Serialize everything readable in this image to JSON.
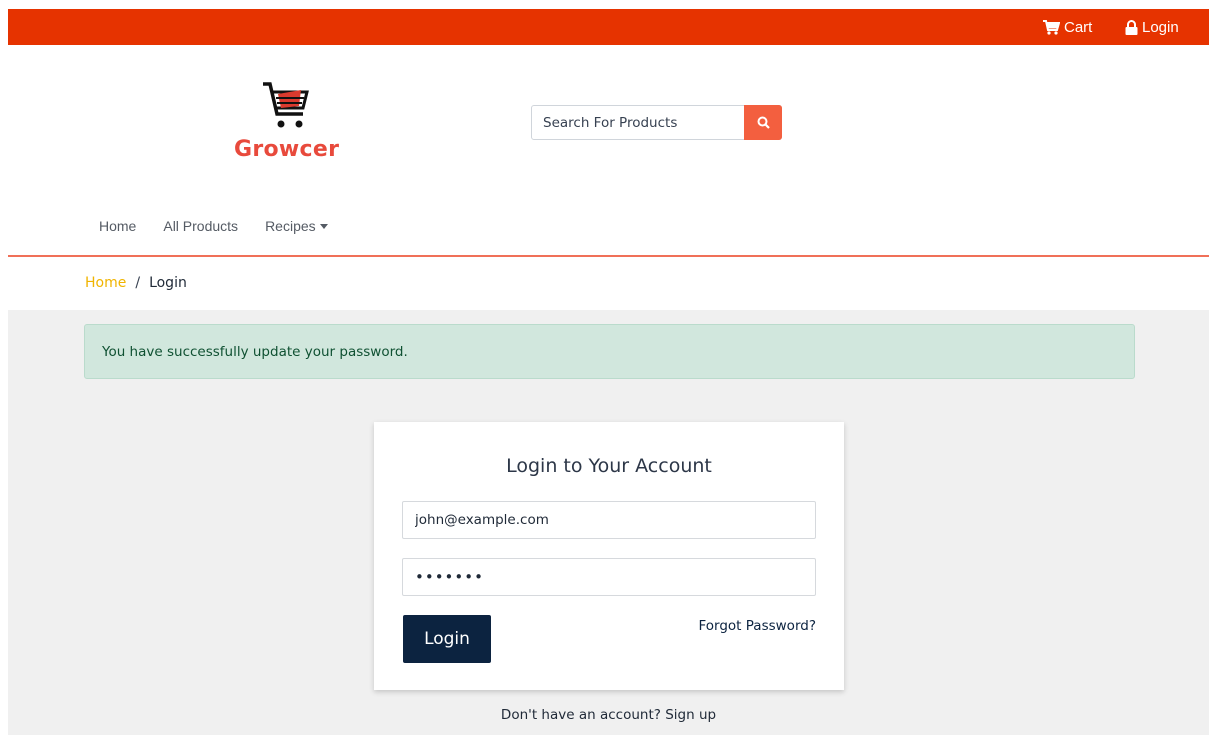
{
  "topbar": {
    "cart_label": "Cart",
    "cart_icon": "cart-icon",
    "login_label": "Login",
    "login_icon": "lock-icon",
    "background_color": "#e63300"
  },
  "brand": {
    "name": "Growcer",
    "logo_icon": "shopping-cart-icon",
    "color": "#e84a3c"
  },
  "search": {
    "placeholder": "Search For Products",
    "button_icon": "search-icon",
    "button_color": "#f35f3f"
  },
  "nav": {
    "items": [
      {
        "label": "Home"
      },
      {
        "label": "All Products"
      },
      {
        "label": "Recipes",
        "has_dropdown": true
      }
    ]
  },
  "breadcrumb": {
    "home": "Home",
    "separator": "/",
    "current": "Login"
  },
  "alert": {
    "message": "You have successfully update your password.",
    "type": "success"
  },
  "login_form": {
    "title": "Login to Your Account",
    "email_value": "john@example.com",
    "password_value": "•••••••",
    "submit_label": "Login",
    "forgot_label": "Forgot Password?",
    "signup_text": "Don't have an account? Sign up",
    "button_color": "#0c2340"
  }
}
